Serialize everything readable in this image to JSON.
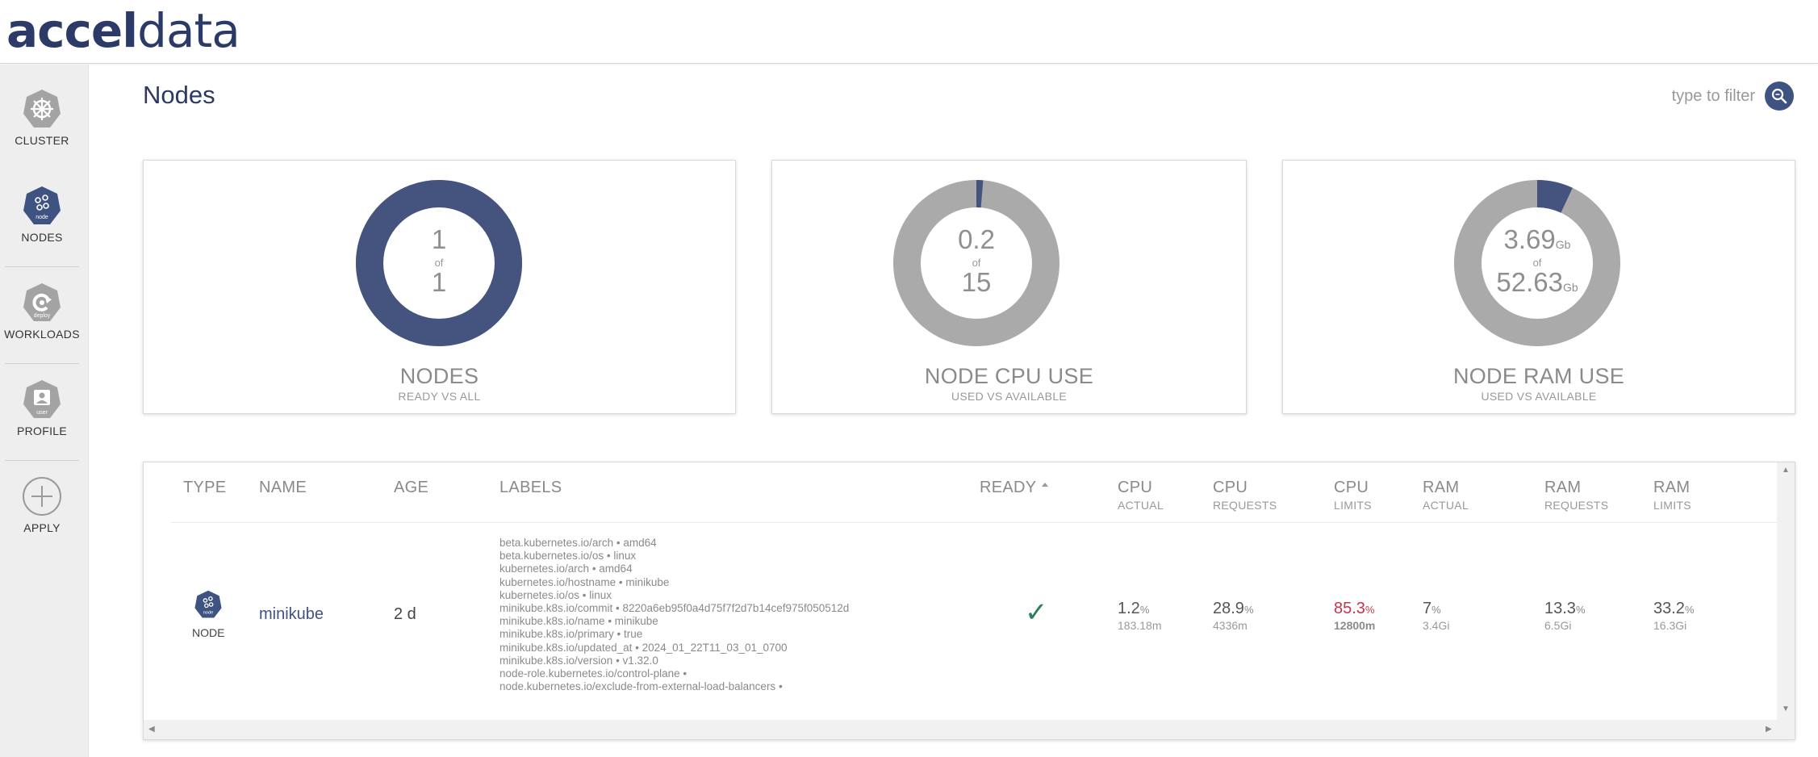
{
  "brand": {
    "bold": "accel",
    "light": "data"
  },
  "page": {
    "title": "Nodes"
  },
  "filter": {
    "placeholder": "type to filter"
  },
  "sidebar": {
    "items": [
      {
        "label": "CLUSTER",
        "icon": "helm-wheel-icon"
      },
      {
        "label": "NODES",
        "icon": "node-icon",
        "icon_text": "node",
        "active": true
      },
      {
        "label": "WORKLOADS",
        "icon": "deploy-icon",
        "icon_text": "deploy"
      },
      {
        "label": "PROFILE",
        "icon": "user-icon",
        "icon_text": "user"
      },
      {
        "label": "APPLY",
        "icon": "plus-circle-icon"
      }
    ]
  },
  "cards": [
    {
      "value": "1",
      "of": "of",
      "total": "1",
      "title": "NODES",
      "subtitle": "READY VS ALL",
      "fraction": 1.0
    },
    {
      "value": "0.2",
      "of": "of",
      "total": "15",
      "title": "NODE CPU USE",
      "subtitle": "USED VS AVAILABLE",
      "fraction": 0.013
    },
    {
      "value": "3.69",
      "value_unit": "Gb",
      "of": "of",
      "total": "52.63",
      "total_unit": "Gb",
      "title": "NODE RAM USE",
      "subtitle": "USED VS AVAILABLE",
      "fraction": 0.07
    }
  ],
  "colors": {
    "accent": "#3f5382",
    "donut_fill": "#44547f",
    "donut_empty": "#aaaaaa",
    "alert": "#c8334c",
    "check": "#2e7d5b"
  },
  "table": {
    "headers": {
      "type": "TYPE",
      "name": "NAME",
      "age": "AGE",
      "labels": "LABELS",
      "ready": "READY",
      "cpu_actual": {
        "main": "CPU",
        "sub": "ACTUAL"
      },
      "cpu_requests": {
        "main": "CPU",
        "sub": "REQUESTS"
      },
      "cpu_limits": {
        "main": "CPU",
        "sub": "LIMITS"
      },
      "ram_actual": {
        "main": "RAM",
        "sub": "ACTUAL"
      },
      "ram_requests": {
        "main": "RAM",
        "sub": "REQUESTS"
      },
      "ram_limits": {
        "main": "RAM",
        "sub": "LIMITS"
      }
    },
    "row": {
      "type": "NODE",
      "type_icon_text": "node",
      "name": "minikube",
      "age": "2 d",
      "labels": [
        "beta.kubernetes.io/arch • amd64",
        "beta.kubernetes.io/os • linux",
        "kubernetes.io/arch • amd64",
        "kubernetes.io/hostname • minikube",
        "kubernetes.io/os • linux",
        "minikube.k8s.io/commit • 8220a6eb95f0a4d75f7f2d7b14cef975f050512d",
        "minikube.k8s.io/name • minikube",
        "minikube.k8s.io/primary • true",
        "minikube.k8s.io/updated_at • 2024_01_22T11_03_01_0700",
        "minikube.k8s.io/version • v1.32.0",
        "node-role.kubernetes.io/control-plane •",
        "node.kubernetes.io/exclude-from-external-load-balancers •"
      ],
      "ready": "✓",
      "cpu_actual": {
        "value": "1.2",
        "unit": "%",
        "sub": "183.18m"
      },
      "cpu_requests": {
        "value": "28.9",
        "unit": "%",
        "sub": "4336m"
      },
      "cpu_limits": {
        "value": "85.3",
        "unit": "%",
        "sub": "12800m"
      },
      "ram_actual": {
        "value": "7",
        "unit": "%",
        "sub": "3.4Gi"
      },
      "ram_requests": {
        "value": "13.3",
        "unit": "%",
        "sub": "6.5Gi"
      },
      "ram_limits": {
        "value": "33.2",
        "unit": "%",
        "sub": "16.3Gi"
      }
    }
  }
}
